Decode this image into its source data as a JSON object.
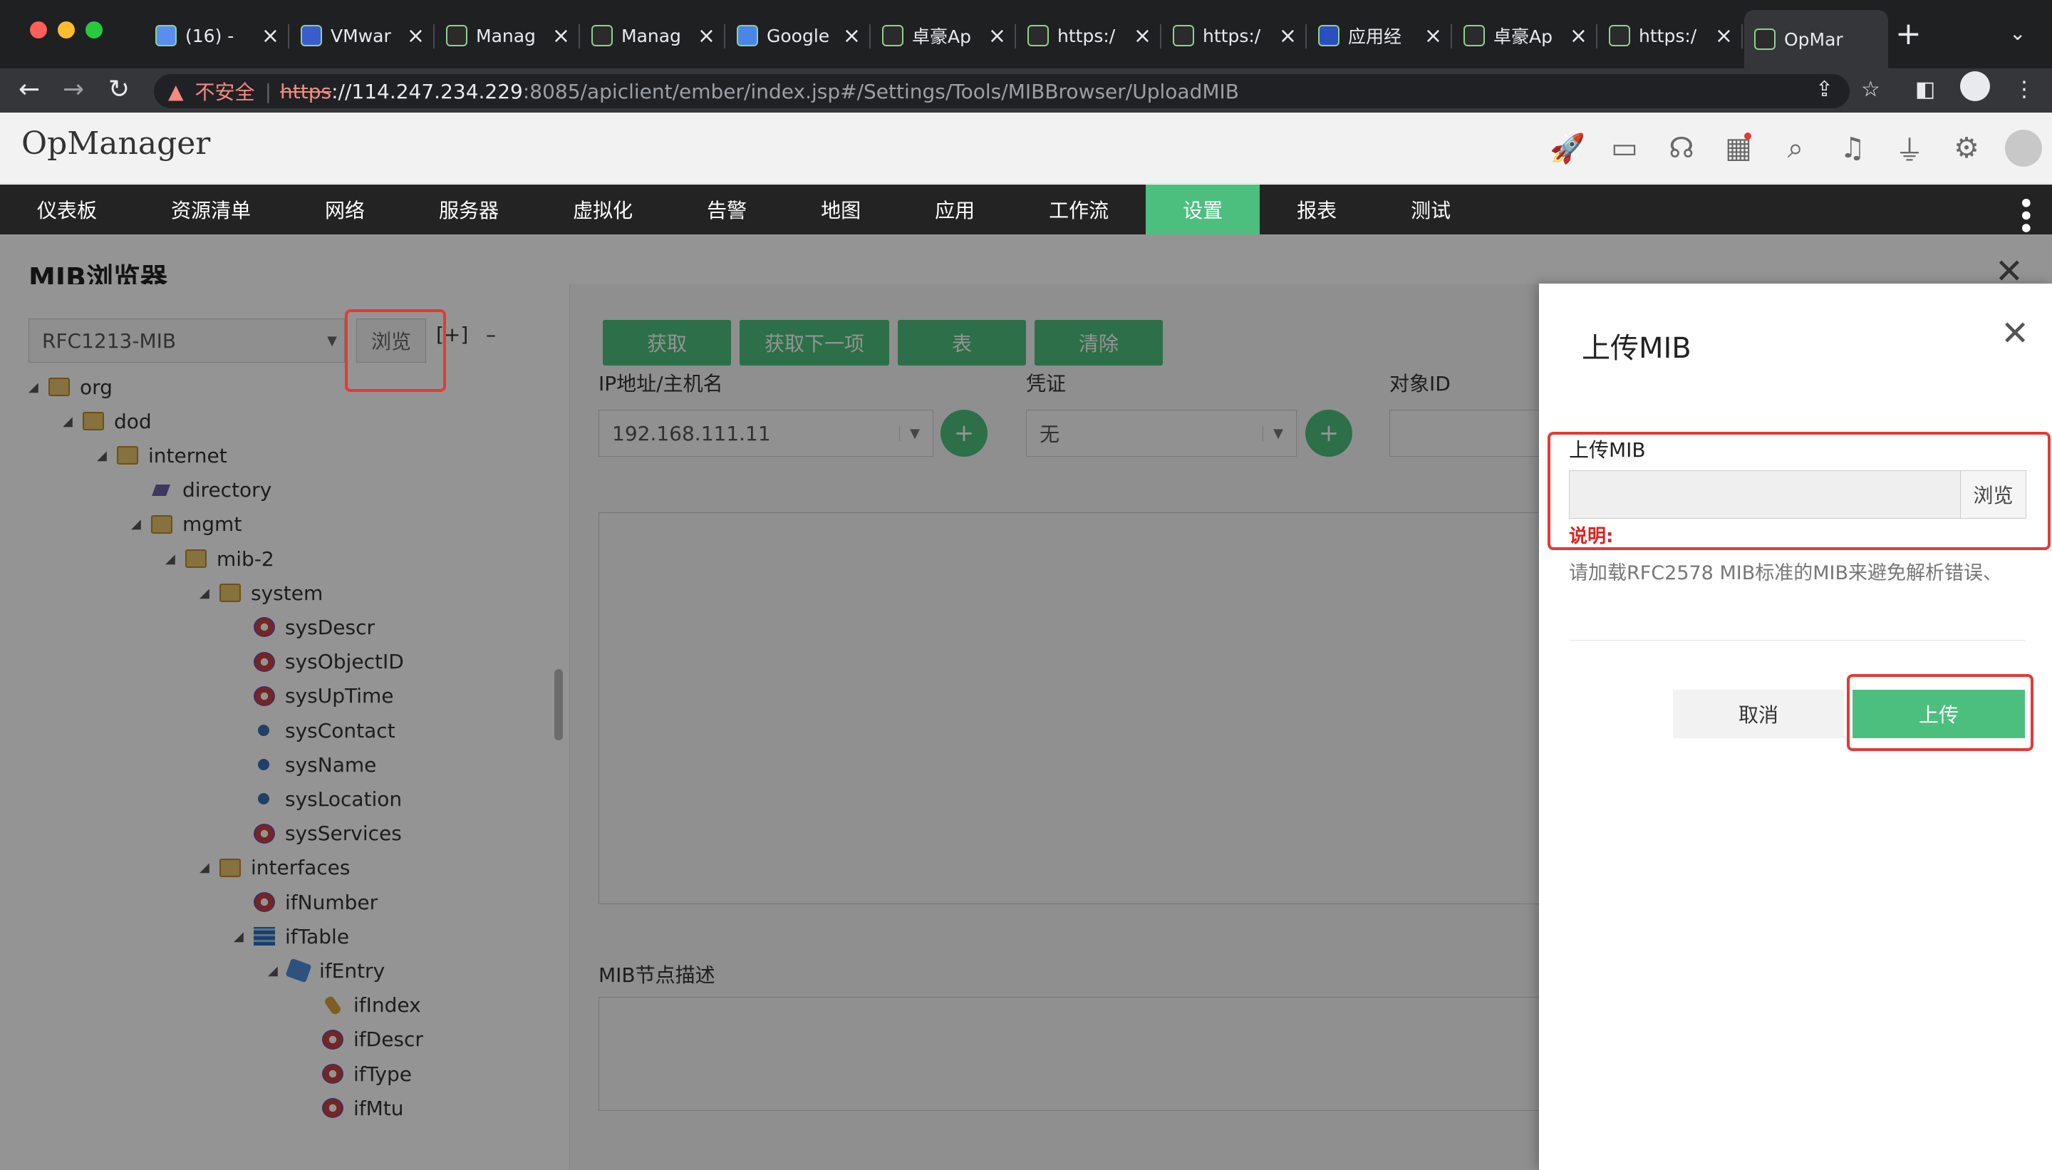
{
  "browser": {
    "tabs": [
      {
        "title": "(16) - ",
        "favicon": "home-icon"
      },
      {
        "title": "VMwar",
        "favicon": "vmware-icon"
      },
      {
        "title": "Manag",
        "favicon": "opmanager-icon"
      },
      {
        "title": "Manag",
        "favicon": "opmanager-icon"
      },
      {
        "title": "Google",
        "favicon": "google-translate-icon"
      },
      {
        "title": "卓豪Ap",
        "favicon": "opmanager-icon"
      },
      {
        "title": "https:/",
        "favicon": "opmanager-icon"
      },
      {
        "title": "https:/",
        "favicon": "opmanager-icon"
      },
      {
        "title": "应用经",
        "favicon": "app-icon"
      },
      {
        "title": "卓豪Ap",
        "favicon": "opmanager-icon"
      },
      {
        "title": "https:/",
        "favicon": "opmanager-icon"
      },
      {
        "title": "OpMar",
        "favicon": "opmanager-icon",
        "active": true
      }
    ],
    "new_tab": "+",
    "security_label": "不安全",
    "url_scheme": "https",
    "url_host": "://114.247.234.229",
    "url_path": ":8085/apiclient/ember/index.jsp#/Settings/Tools/MIBBrowser/UploadMIB"
  },
  "app": {
    "brand": "OpManager",
    "header_icons": [
      "rocket-icon",
      "monitor-icon",
      "headset-icon",
      "gift-icon",
      "search-icon",
      "bell-icon",
      "plug-icon",
      "gear-icon",
      "user-avatar-icon"
    ],
    "nav": [
      "仪表板",
      "资源清单",
      "网络",
      "服务器",
      "虚拟化",
      "告警",
      "地图",
      "应用",
      "工作流",
      "设置",
      "报表",
      "测试"
    ],
    "active_nav": "设置"
  },
  "page": {
    "title": "MIB浏览器",
    "mib_select": "RFC1213-MIB",
    "browse": "浏览",
    "tree_expand": "[+]",
    "tree_collapse": "–",
    "tree": [
      {
        "label": "org",
        "level": 0,
        "icon": "folder",
        "toggle": "◢"
      },
      {
        "label": "dod",
        "level": 1,
        "icon": "folder",
        "toggle": "◢"
      },
      {
        "label": "internet",
        "level": 2,
        "icon": "folder",
        "toggle": "◢"
      },
      {
        "label": "directory",
        "level": 3,
        "icon": "dir",
        "toggle": ""
      },
      {
        "label": "mgmt",
        "level": 3,
        "icon": "folder",
        "toggle": "◢"
      },
      {
        "label": "mib-2",
        "level": 4,
        "icon": "folder",
        "toggle": "◢"
      },
      {
        "label": "system",
        "level": 5,
        "icon": "folder",
        "toggle": "◢"
      },
      {
        "label": "sysDescr",
        "level": 6,
        "icon": "leaf",
        "toggle": ""
      },
      {
        "label": "sysObjectID",
        "level": 6,
        "icon": "leaf",
        "toggle": ""
      },
      {
        "label": "sysUpTime",
        "level": 6,
        "icon": "leaf",
        "toggle": ""
      },
      {
        "label": "sysContact",
        "level": 6,
        "icon": "dot",
        "toggle": ""
      },
      {
        "label": "sysName",
        "level": 6,
        "icon": "dot",
        "toggle": ""
      },
      {
        "label": "sysLocation",
        "level": 6,
        "icon": "dot",
        "toggle": ""
      },
      {
        "label": "sysServices",
        "level": 6,
        "icon": "leaf",
        "toggle": ""
      },
      {
        "label": "interfaces",
        "level": 5,
        "icon": "folder",
        "toggle": "◢"
      },
      {
        "label": "ifNumber",
        "level": 6,
        "icon": "leaf",
        "toggle": ""
      },
      {
        "label": "ifTable",
        "level": 6,
        "icon": "table",
        "toggle": "◢"
      },
      {
        "label": "ifEntry",
        "level": 7,
        "icon": "entry",
        "toggle": "◢"
      },
      {
        "label": "ifIndex",
        "level": 8,
        "icon": "key",
        "toggle": ""
      },
      {
        "label": "ifDescr",
        "level": 8,
        "icon": "leaf",
        "toggle": ""
      },
      {
        "label": "ifType",
        "level": 8,
        "icon": "leaf",
        "toggle": ""
      },
      {
        "label": "ifMtu",
        "level": 8,
        "icon": "leaf",
        "toggle": ""
      }
    ],
    "actions": [
      "获取",
      "获取下一项",
      "表",
      "清除"
    ],
    "ip_label": "IP地址/主机名",
    "ip_value": "192.168.111.11",
    "cred_label": "凭证",
    "cred_value": "无",
    "oid_label": "对象ID",
    "desc_label": "MIB节点描述"
  },
  "modal": {
    "title": "上传MIB",
    "field_label": "上传MIB",
    "browse": "浏览",
    "note_label": "说明:",
    "note_text": "请加载RFC2578 MIB标准的MIB来避免解析错误、",
    "cancel": "取消",
    "upload": "上传"
  },
  "colors": {
    "accent": "#4cbf7f",
    "highlight": "#e53935"
  }
}
